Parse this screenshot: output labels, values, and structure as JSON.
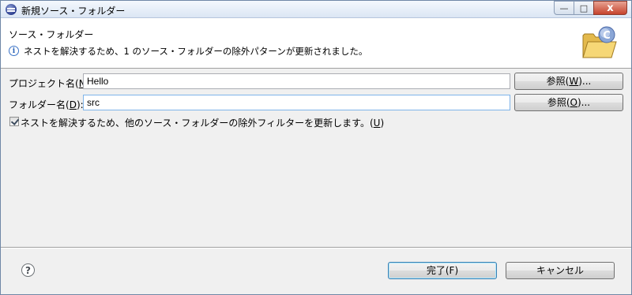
{
  "window": {
    "title": "新規ソース・フォルダー",
    "minimize_glyph": "—",
    "maximize_glyph": "□",
    "close_glyph": "x"
  },
  "banner": {
    "title": "ソース・フォルダー",
    "message": "ネストを解決するため、1 のソース・フォルダーの除外パターンが更新されました。",
    "info_icon": "info-icon",
    "image_icon": "new-source-folder-icon",
    "icon_letter": "C"
  },
  "form": {
    "project_label": "プロジェクト名(",
    "project_mnemonic": "N",
    "project_label_end": "):",
    "project_value": "Hello",
    "project_browse_label": "参照(",
    "project_browse_mnemonic": "W",
    "project_browse_end": ")...",
    "folder_label": "フォルダー名(",
    "folder_mnemonic": "D",
    "folder_label_end": "):",
    "folder_value": "src",
    "folder_browse_label": "参照(",
    "folder_browse_mnemonic": "O",
    "folder_browse_end": ")...",
    "checkbox_checked": true,
    "checkbox_label": "ネストを解決するため、他のソース・フォルダーの除外フィルターを更新します。(",
    "checkbox_mnemonic": "U",
    "checkbox_label_end": ")"
  },
  "footer": {
    "help_glyph": "?",
    "finish_label": "完了(F)",
    "cancel_label": "キャンセル"
  }
}
